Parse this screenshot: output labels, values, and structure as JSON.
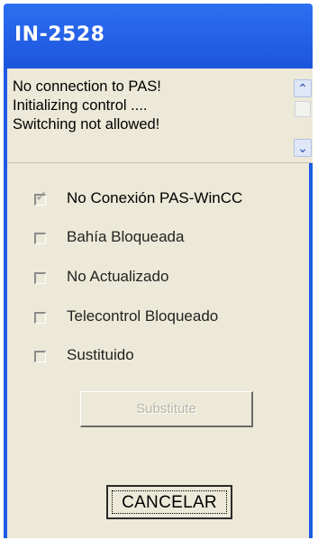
{
  "window": {
    "title": "IN-2528"
  },
  "messages": [
    "No connection to PAS!",
    "Initializing control ....",
    "Switching not allowed!"
  ],
  "scrollbar": {
    "up_icon": "chevron-up-icon",
    "down_icon": "chevron-down-icon"
  },
  "options": [
    {
      "label": "No Conexión PAS-WinCC",
      "checked": true
    },
    {
      "label": "Bahía Bloqueada",
      "checked": false
    },
    {
      "label": "No Actualizado",
      "checked": false
    },
    {
      "label": "Telecontrol Bloqueado",
      "checked": false
    },
    {
      "label": "Sustituido",
      "checked": false
    }
  ],
  "buttons": {
    "substitute_label": "Substitute",
    "cancel_label": "CANCELAR"
  }
}
